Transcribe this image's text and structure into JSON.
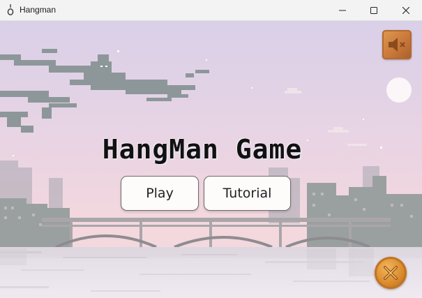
{
  "window": {
    "title": "Hangman",
    "icon": "noose-icon"
  },
  "controls": {
    "minimize_icon": "minimize-icon",
    "maximize_icon": "maximize-icon",
    "close_icon": "close-icon"
  },
  "game": {
    "title": "HangMan Game"
  },
  "menu": {
    "play_label": "Play",
    "tutorial_label": "Tutorial"
  },
  "buttons": {
    "sound_icon": "speaker-muted-icon",
    "exit_icon": "exit-x-icon"
  },
  "colors": {
    "sky_top": "#dcd3ea",
    "sky_mid": "#ead6e4",
    "sky_low": "#f4d9de",
    "water": "#e9e2ea",
    "city": "#8f9798",
    "wood": "#c9783a",
    "coin": "#d98a2c"
  }
}
